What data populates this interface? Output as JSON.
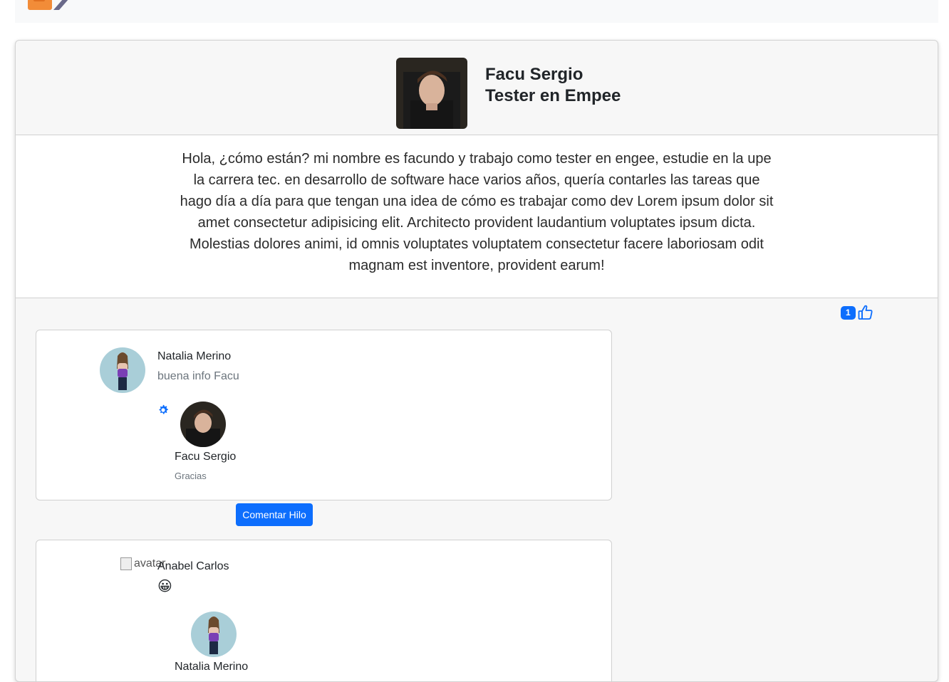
{
  "header": {
    "logo_icon": "brand-logo-icon"
  },
  "post": {
    "author_name": "Facu Sergio",
    "author_role": "Tester en Empee",
    "body": "Hola, ¿cómo están? mi nombre es facundo y trabajo como tester en engee, estudie en la upe la carrera tec. en desarrollo de software hace varios años, quería contarles las tareas que hago día a día para que tengan una idea de cómo es trabajar como dev Lorem ipsum dolor sit amet consectetur adipisicing elit. Architecto provident laudantium voluptates ipsum dicta. Molestias dolores animi, id omnis voluptates voluptatem consectetur facere laboriosam odit magnam est inventore, provident earum!",
    "likes_count": "1",
    "like_icon": "thumbs-up-icon"
  },
  "comments": [
    {
      "author": "Natalia Merino",
      "text": "buena info Facu",
      "settings_icon": "gear-icon",
      "reply": {
        "author": "Facu Sergio",
        "text": "Gracias"
      },
      "thread_button_label": "Comentar Hilo"
    },
    {
      "author": "Anabel Carlos",
      "avatar_alt": "avatar",
      "text_emoji": "😀",
      "reply": {
        "author": "Natalia Merino"
      }
    }
  ],
  "colors": {
    "primary": "#0d6efd",
    "card_bg": "#f7f7f7",
    "muted_text": "#6c757d"
  }
}
